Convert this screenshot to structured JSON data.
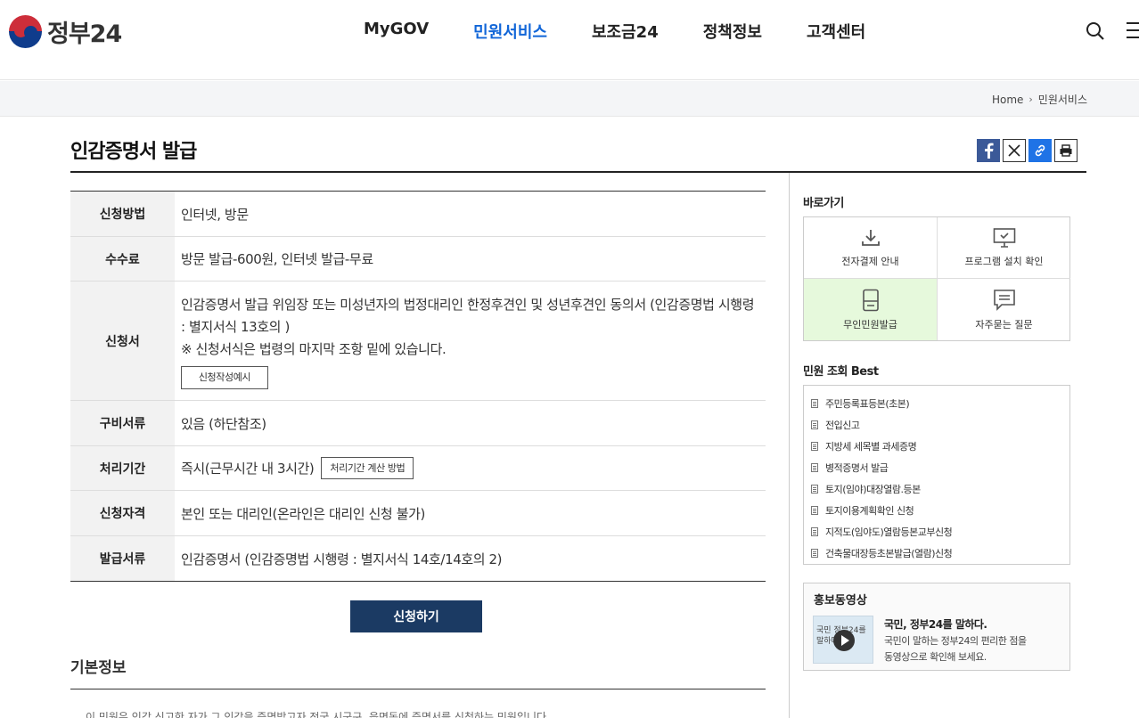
{
  "header": {
    "logo_text": "정부24",
    "nav": [
      {
        "label": "MyGOV",
        "active": false
      },
      {
        "label": "민원서비스",
        "active": true
      },
      {
        "label": "보조금24",
        "active": false
      },
      {
        "label": "정책정보",
        "active": false
      },
      {
        "label": "고객센터",
        "active": false
      }
    ],
    "icons": [
      "search-icon",
      "menu-icon"
    ]
  },
  "breadcrumb": {
    "home": "Home",
    "current": "민원서비스"
  },
  "page": {
    "title": "인감증명서 발급",
    "share_icons": [
      "facebook-icon",
      "x-icon",
      "link-icon",
      "print-icon"
    ]
  },
  "info": {
    "method": {
      "label": "신청방법",
      "value": "인터넷, 방문"
    },
    "fee": {
      "label": "수수료",
      "value": "방문 발급-600원, 인터넷 발급-무료"
    },
    "form": {
      "label": "신청서",
      "line1": "인감증명서 발급 위임장 또는 미성년자의 법정대리인 한정후견인 및 성년후견인 동의서 (인감증명법 시행령",
      "line2": ": 별지서식 13호의 )",
      "line3": "※ 신청서식은 법령의 마지막 조항 밑에 있습니다.",
      "button": "신청작성예시"
    },
    "docs": {
      "label": "구비서류",
      "value": "있음 (하단참조)"
    },
    "time": {
      "label": "처리기간",
      "value": "즉시(근무시간 내 3시간)",
      "button": "처리기간 계산 방법"
    },
    "eligibility": {
      "label": "신청자격",
      "value": "본인 또는 대리인(온라인은 대리인 신청 불가)"
    },
    "issue": {
      "label": "발급서류",
      "value": "인감증명서 (인감증명법 시행령 : 별지서식 14호/14호의 2)"
    }
  },
  "apply_button": "신청하기",
  "basic": {
    "title": "기본정보",
    "text": "이 민원은 인감 신고한 자가 그 인감을 증명받고자 전국 시군구, 읍면동에 증명서를 신청하는 민원입니다."
  },
  "sidebar": {
    "quick_title": "바로가기",
    "quick": [
      {
        "label": "전자결제 안내",
        "icon": "download-icon",
        "highlight": false
      },
      {
        "label": "프로그램 설치 확인",
        "icon": "monitor-check-icon",
        "highlight": false
      },
      {
        "label": "무인민원발급",
        "icon": "kiosk-icon",
        "highlight": true
      },
      {
        "label": "자주묻는 질문",
        "icon": "chat-icon",
        "highlight": false
      }
    ],
    "best_title": "민원 조회 Best",
    "best": [
      "주민등록표등본(초본)",
      "전입신고",
      "지방세 세목별 과세증명",
      "병적증명서 발급",
      "토지(임야)대장열람.등본",
      "토지이용계획확인 신청",
      "지적도(임야도)열람등본교부신청",
      "건축물대장등초본발급(열람)신청"
    ],
    "promo": {
      "title": "홍보동영상",
      "thumb_text": "국민 정부24를 말하다",
      "headline": "국민, 정부24를 말하다.",
      "desc1": "국민이 말하는 정부24의 편리한 점을",
      "desc2": "동영상으로 확인해 보세요."
    }
  }
}
